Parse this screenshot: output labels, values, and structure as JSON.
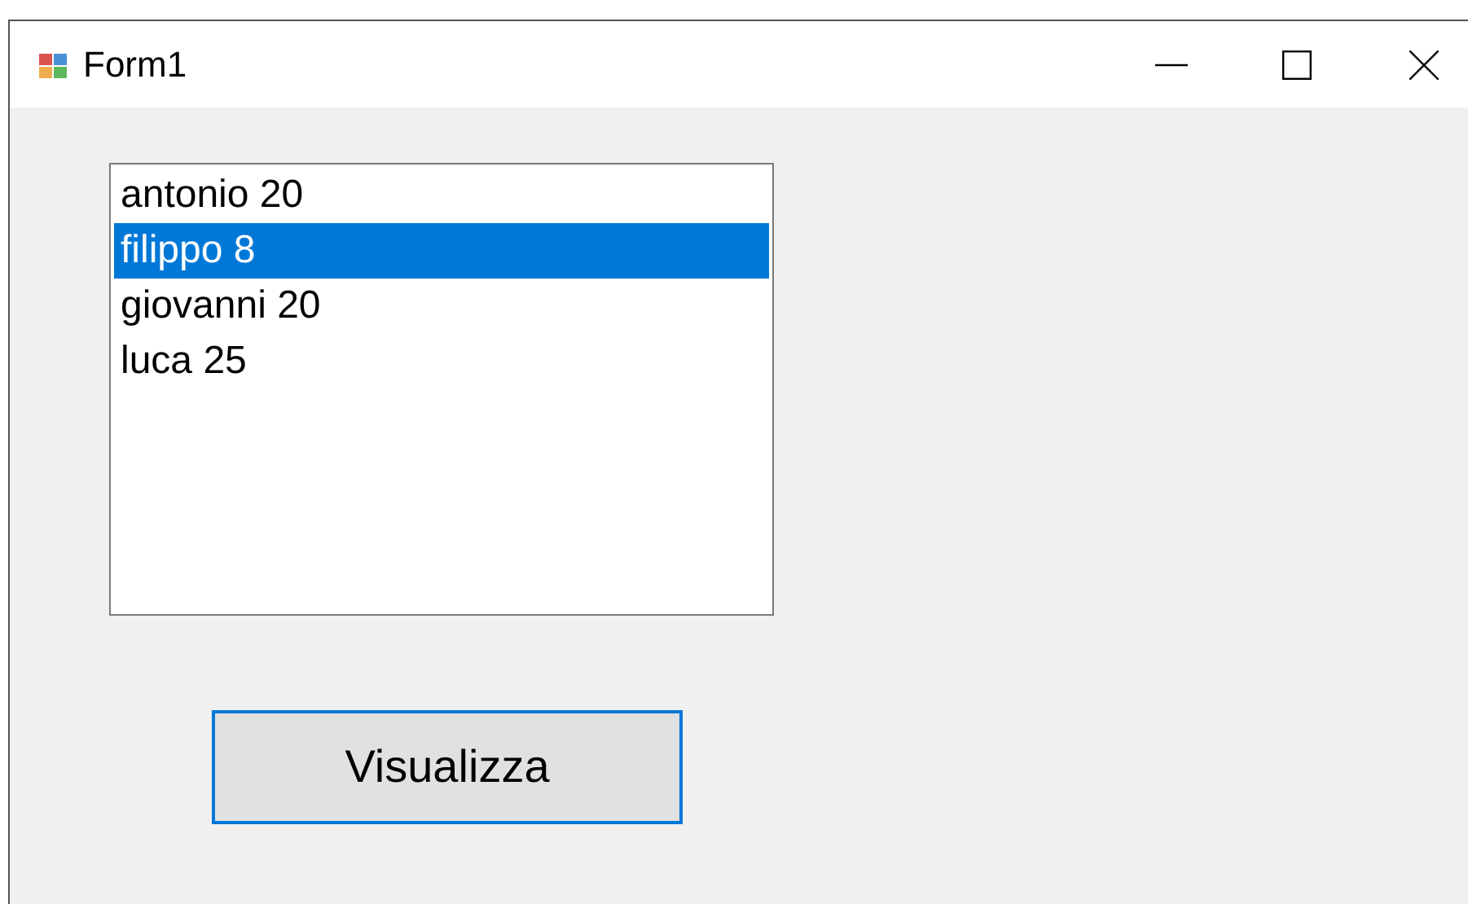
{
  "window": {
    "title": "Form1"
  },
  "listbox": {
    "items": [
      {
        "text": "antonio 20",
        "selected": false
      },
      {
        "text": "filippo 8",
        "selected": true
      },
      {
        "text": "giovanni 20",
        "selected": false
      },
      {
        "text": "luca 25",
        "selected": false
      }
    ]
  },
  "button": {
    "label": "Visualizza"
  }
}
